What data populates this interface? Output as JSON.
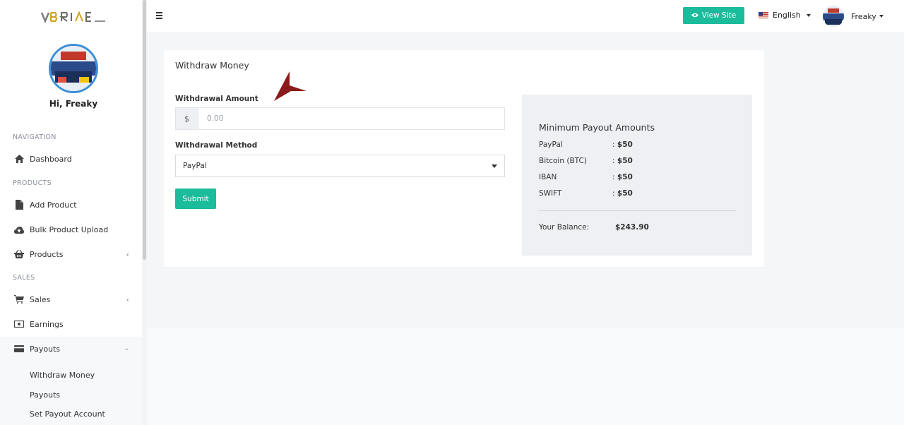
{
  "sidebar": {
    "greeting": "Hi, Freaky",
    "sections": {
      "navigation": "NAVIGATION",
      "products": "PRODUCTS",
      "sales": "SALES"
    },
    "items": {
      "dashboard": "Dashboard",
      "add_product": "Add Product",
      "bulk_upload": "Bulk Product Upload",
      "products": "Products",
      "sales": "Sales",
      "earnings": "Earnings",
      "payouts": "Payouts"
    },
    "payouts_sub": {
      "withdraw_money": "Withdraw Money",
      "payouts": "Payouts",
      "set_payout_account": "Set Payout Account"
    }
  },
  "topbar": {
    "view_site": "View Site",
    "language": "English",
    "username": "Freaky"
  },
  "withdraw": {
    "title": "Withdraw Money",
    "amount_label": "Withdrawal Amount",
    "currency_symbol": "$",
    "amount_placeholder": "0.00",
    "method_label": "Withdrawal Method",
    "method_selected": "PayPal",
    "submit_label": "Submit"
  },
  "payout_panel": {
    "title": "Minimum Payout Amounts",
    "rows": [
      {
        "name": "PayPal",
        "amount": "$50"
      },
      {
        "name": "Bitcoin (BTC)",
        "amount": "$50"
      },
      {
        "name": "IBAN",
        "amount": "$50"
      },
      {
        "name": "SWIFT",
        "amount": "$50"
      }
    ],
    "separator": ":",
    "balance_label": "Your Balance:",
    "balance_value": "$243.90"
  },
  "colors": {
    "accent": "#1abc9c",
    "avatar_ring": "#3d8fd6",
    "annotation_arrow": "#8b1a1a"
  }
}
